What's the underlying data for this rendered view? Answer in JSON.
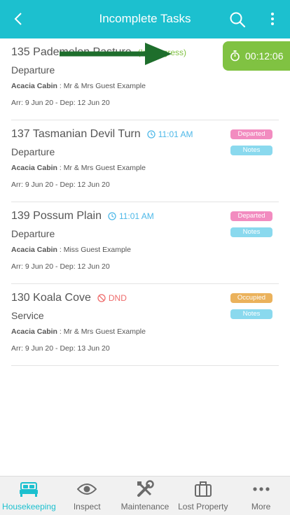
{
  "header": {
    "title": "Incomplete Tasks",
    "back_icon": "chevron-left-icon",
    "search_icon": "search-icon",
    "menu_icon": "kebab-menu-icon"
  },
  "colors": {
    "accent": "#1cc0cf",
    "in_progress": "#80c242",
    "time": "#4db8e8",
    "dnd": "#ee6b6b",
    "departed": "#f28cc0",
    "occupied": "#ebb25c",
    "notes": "#8ad9ee"
  },
  "timer": {
    "value": "00:12:06",
    "icon": "stopwatch-icon"
  },
  "tasks": [
    {
      "room": "135 Pademelon Pasture",
      "tag": {
        "kind": "progress",
        "text": "(In Progress)"
      },
      "type": "Departure",
      "cabin": "Acacia Cabin",
      "guest": " : Mr & Mrs Guest Example",
      "dates": "Arr: 9 Jun 20 - Dep: 12 Jun 20",
      "status": "",
      "notes": ""
    },
    {
      "room": "137 Tasmanian Devil Turn",
      "tag": {
        "kind": "time",
        "text": "11:01 AM"
      },
      "type": "Departure",
      "cabin": "Acacia Cabin",
      "guest": " : Mr & Mrs Guest Example",
      "dates": "Arr: 9 Jun 20 - Dep: 12 Jun 20",
      "status": "Departed",
      "notes": "Notes"
    },
    {
      "room": "139 Possum Plain",
      "tag": {
        "kind": "time",
        "text": "11:01 AM"
      },
      "type": "Departure",
      "cabin": "Acacia Cabin",
      "guest": " : Miss Guest Example",
      "dates": "Arr: 9 Jun 20 - Dep: 12 Jun 20",
      "status": "Departed",
      "notes": "Notes"
    },
    {
      "room": "130 Koala Cove",
      "tag": {
        "kind": "dnd",
        "text": "DND"
      },
      "type": "Service",
      "cabin": "Acacia Cabin",
      "guest": " : Mr & Mrs Guest Example",
      "dates": "Arr: 9 Jun 20 - Dep: 13 Jun 20",
      "status": "Occupied",
      "notes": "Notes"
    }
  ],
  "nav": [
    {
      "label": "Housekeeping",
      "icon": "bed-icon",
      "active": true
    },
    {
      "label": "Inspect",
      "icon": "eye-icon",
      "active": false
    },
    {
      "label": "Maintenance",
      "icon": "tools-icon",
      "active": false
    },
    {
      "label": "Lost Property",
      "icon": "briefcase-icon",
      "active": false
    },
    {
      "label": "More",
      "icon": "more-dots-icon",
      "active": false
    }
  ]
}
